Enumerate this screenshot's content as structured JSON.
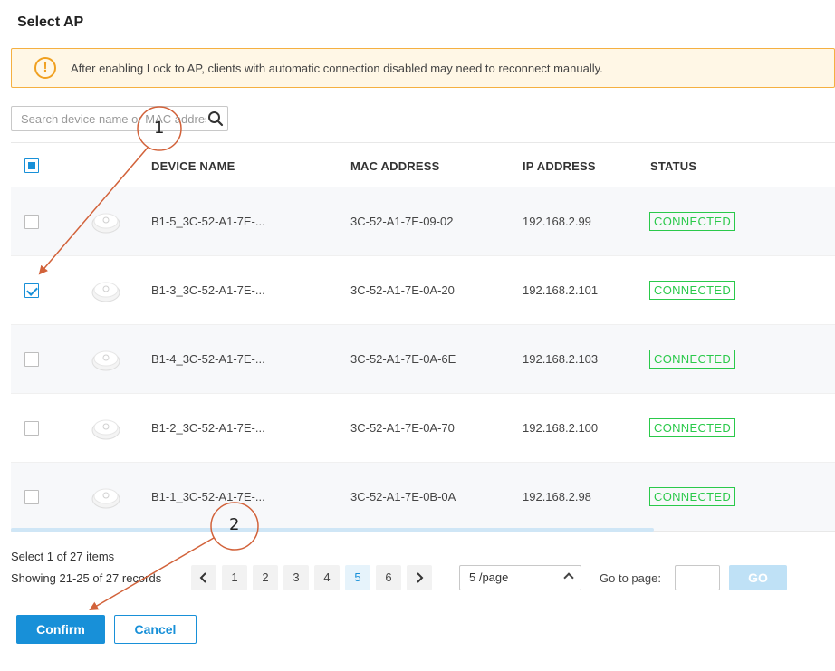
{
  "dialog": {
    "title": "Select AP"
  },
  "warning": {
    "text": "After enabling Lock to AP, clients with automatic connection disabled may need to reconnect manually.",
    "color": "#f0a020"
  },
  "search": {
    "placeholder": "Search device name or MAC address",
    "value": ""
  },
  "table": {
    "columns": [
      "DEVICE NAME",
      "MAC ADDRESS",
      "IP ADDRESS",
      "STATUS"
    ],
    "rows": [
      {
        "name": "B1-5_3C-52-A1-7E-...",
        "mac": "3C-52-A1-7E-09-02",
        "ip": "192.168.2.99",
        "status": "CONNECTED",
        "checked": false
      },
      {
        "name": "B1-3_3C-52-A1-7E-...",
        "mac": "3C-52-A1-7E-0A-20",
        "ip": "192.168.2.101",
        "status": "CONNECTED",
        "checked": true
      },
      {
        "name": "B1-4_3C-52-A1-7E-...",
        "mac": "3C-52-A1-7E-0A-6E",
        "ip": "192.168.2.103",
        "status": "CONNECTED",
        "checked": false
      },
      {
        "name": "B1-2_3C-52-A1-7E-...",
        "mac": "3C-52-A1-7E-0A-70",
        "ip": "192.168.2.100",
        "status": "CONNECTED",
        "checked": false
      },
      {
        "name": "B1-1_3C-52-A1-7E-...",
        "mac": "3C-52-A1-7E-0B-0A",
        "ip": "192.168.2.98",
        "status": "CONNECTED",
        "checked": false
      }
    ]
  },
  "footer": {
    "select_info": "Select 1 of 27 items",
    "showing": "Showing 21-25 of 27 records",
    "pages": [
      "1",
      "2",
      "3",
      "4",
      "5",
      "6"
    ],
    "current_page": "5",
    "prev_icon": "chevron-left-icon",
    "next_icon": "chevron-right-icon",
    "page_size": "5 /page",
    "goto_label": "Go to page:",
    "goto_value": "",
    "go_label": "GO"
  },
  "actions": {
    "confirm_label": "Confirm",
    "cancel_label": "Cancel"
  },
  "annotations": {
    "step1": "1",
    "step2": "2"
  },
  "colors": {
    "accent": "#1890d8",
    "status_ok": "#2ac94a",
    "annotation": "#d2623a"
  }
}
